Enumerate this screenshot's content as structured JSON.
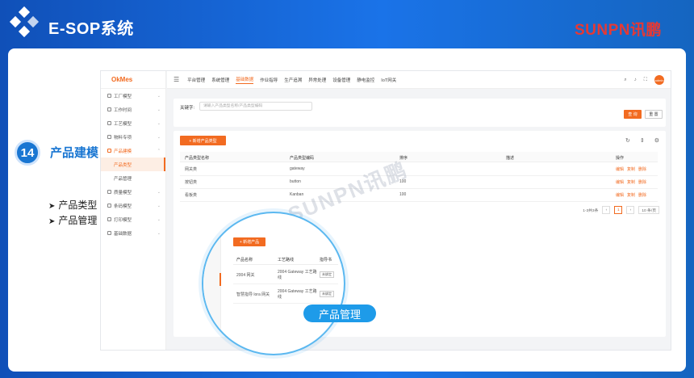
{
  "header": {
    "app_title": "E-SOP系统",
    "brand_latin": "SUNPN",
    "brand_cn": "讯鹏"
  },
  "step": {
    "number": "14",
    "title": "产品建模",
    "bullets": [
      "产品类型",
      "产品管理"
    ]
  },
  "app": {
    "brand": "OkMes",
    "sidebar": [
      {
        "label": "工厂模型"
      },
      {
        "label": "工作时间"
      },
      {
        "label": "工艺模型"
      },
      {
        "label": "物料专项"
      },
      {
        "label": "产品建模"
      },
      {
        "label": "产品类型"
      },
      {
        "label": "产品管理"
      },
      {
        "label": "质量模型"
      },
      {
        "label": "条码模型"
      },
      {
        "label": "打印模型"
      },
      {
        "label": "基础数据"
      }
    ],
    "top_menu": [
      "平台管理",
      "系统管理",
      "基础数据",
      "作业指导",
      "生产追溯",
      "异常处理",
      "设备管理",
      "静电监控",
      "IoT网关"
    ],
    "avatar_text": "admin",
    "search": {
      "label": "关键字:",
      "placeholder": "请输入产品类型名称/产品类型编码",
      "query_btn": "查 询",
      "reset_btn": "重 置"
    },
    "table": {
      "add_btn": "+ 新增产品类型",
      "columns": [
        "产品类型名称",
        "产品类型编码",
        "排序",
        "描述",
        "操作"
      ],
      "rows": [
        {
          "name": "网关类",
          "code": "gateway",
          "sort": "",
          "desc": "",
          "ops": [
            "编辑",
            "复制",
            "删除"
          ]
        },
        {
          "name": "按钮类",
          "code": "button",
          "sort": "100",
          "desc": "",
          "ops": [
            "编辑",
            "复制",
            "删除"
          ]
        },
        {
          "name": "看板类",
          "code": "Kanban",
          "sort": "100",
          "desc": "",
          "ops": [
            "编辑",
            "复制",
            "删除"
          ]
        }
      ],
      "pager": {
        "summary": "1-3共3条",
        "current": "1",
        "page_size": "10 条/页"
      }
    }
  },
  "watermark": "SUNPN讯鹏",
  "zoom": {
    "add_btn": "+ 新增产品",
    "columns": [
      "产品名称",
      "工艺路线",
      "指导书"
    ],
    "rows": [
      {
        "name": "2004 网关",
        "route": "2004 Gateway 工艺路线",
        "tag": "未绑定"
      },
      {
        "name": "智慧指导 lora 网关",
        "route": "2004 Gateway 工艺路线",
        "tag": "未绑定"
      }
    ],
    "label": "产品管理"
  }
}
